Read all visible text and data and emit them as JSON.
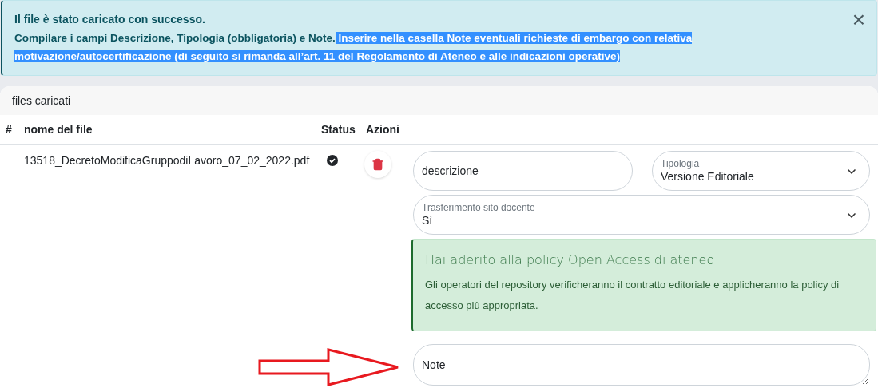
{
  "alert": {
    "title": "Il file è stato caricato con successo.",
    "segments": [
      {
        "kind": "text",
        "text": "Compilare i campi Descrizione, Tipologia (obbligatoria) e Note.",
        "highlighted": false
      },
      {
        "kind": "text",
        "text": " Inserire nella casella Note eventuali richieste di embargo con relativa motivazione/autocertificazione (di seguito si rimanda all’art. 11 del ",
        "highlighted": true
      },
      {
        "kind": "link",
        "text": "Regolamento di Ateneo",
        "highlighted": true
      },
      {
        "kind": "text",
        "text": " e alle ",
        "highlighted": true
      },
      {
        "kind": "link",
        "text": "indicazioni operative",
        "highlighted": true
      },
      {
        "kind": "text",
        "text": ")",
        "highlighted": true
      }
    ],
    "close": "×"
  },
  "card": {
    "title": "files caricati",
    "columns": [
      "#",
      "nome del file",
      "Status",
      "Azioni"
    ],
    "rows": [
      {
        "file": "13518_DecretoModificaGruppodiLavoro_07_02_2022.pdf",
        "done": true,
        "description": {
          "placeholder": "descrizione"
        },
        "tipologia": {
          "label": "Tipologia",
          "value": "Versione Editoriale"
        },
        "trasferimento": {
          "label": "Trasferimento sito docente",
          "value": "Sì"
        },
        "policy": {
          "title": "Hai aderito alla policy Open Access di ateneo",
          "text": "Gli operatori del repository verificheranno il contratto editoriale e applicheranno la policy di accesso più appropriata."
        },
        "note": {
          "placeholder": "Note"
        }
      }
    ]
  }
}
